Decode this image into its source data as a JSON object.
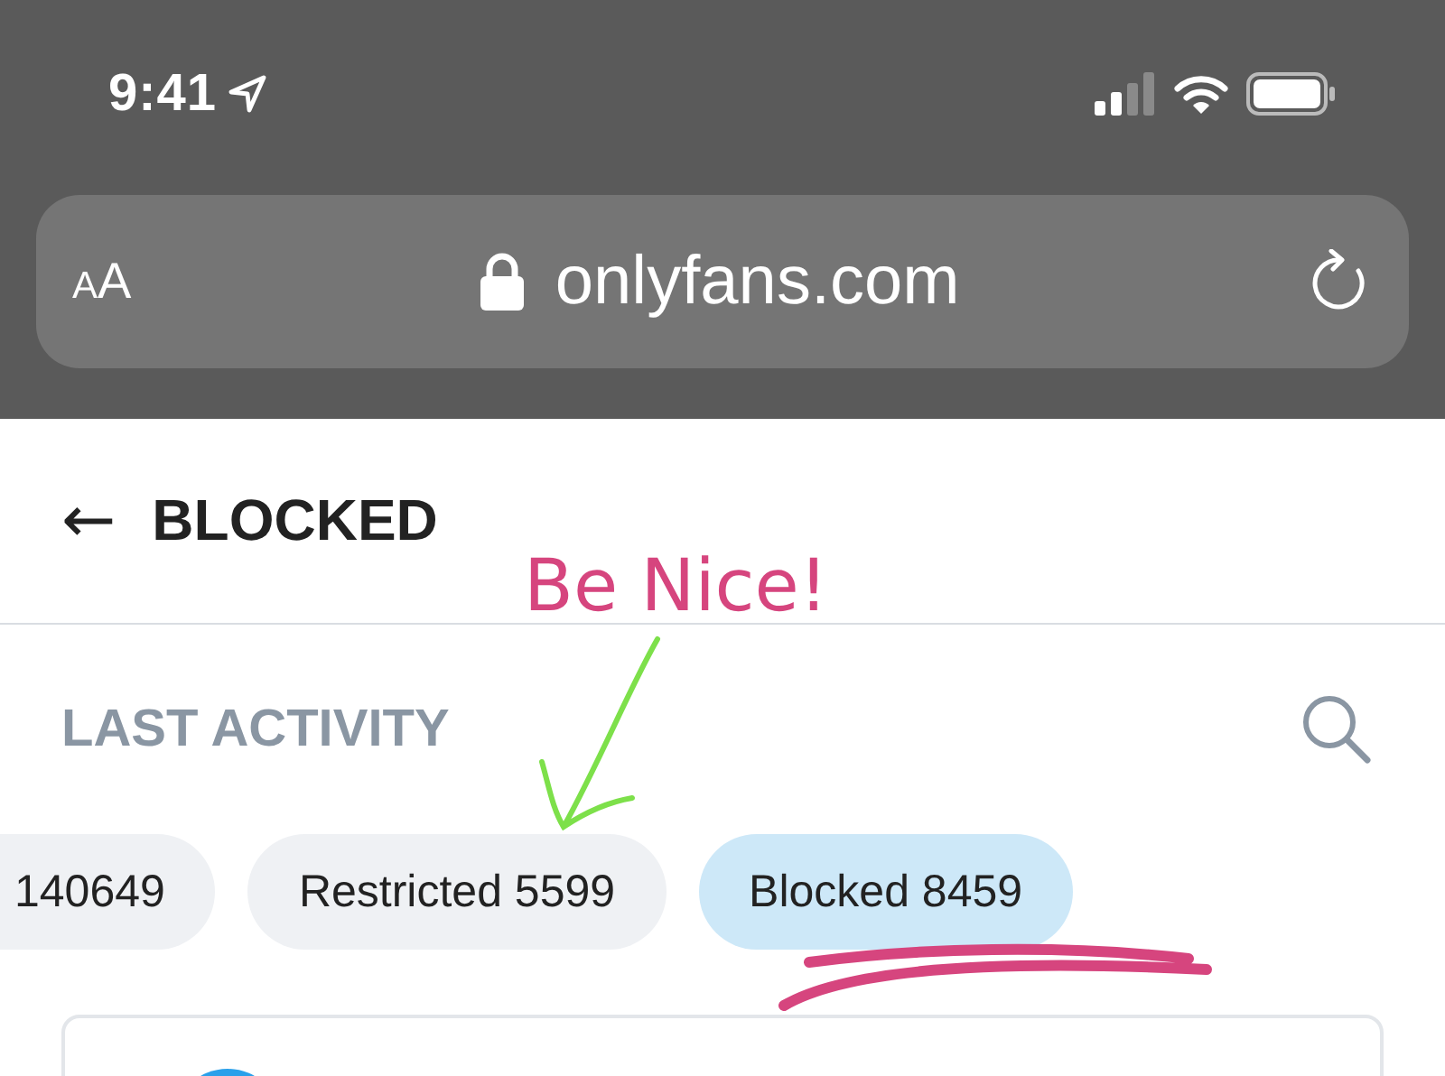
{
  "status_bar": {
    "time": "9:41"
  },
  "address_bar": {
    "text_size_button": "AA",
    "url": "onlyfans.com"
  },
  "header": {
    "back_icon": "←",
    "title": "BLOCKED"
  },
  "section": {
    "title": "LAST ACTIVITY"
  },
  "filters": [
    {
      "label": "140649",
      "selected": false
    },
    {
      "label": "Restricted 5599",
      "selected": false
    },
    {
      "label": "Blocked 8459",
      "selected": true
    }
  ],
  "annotation": {
    "text": "Be Nice!"
  }
}
